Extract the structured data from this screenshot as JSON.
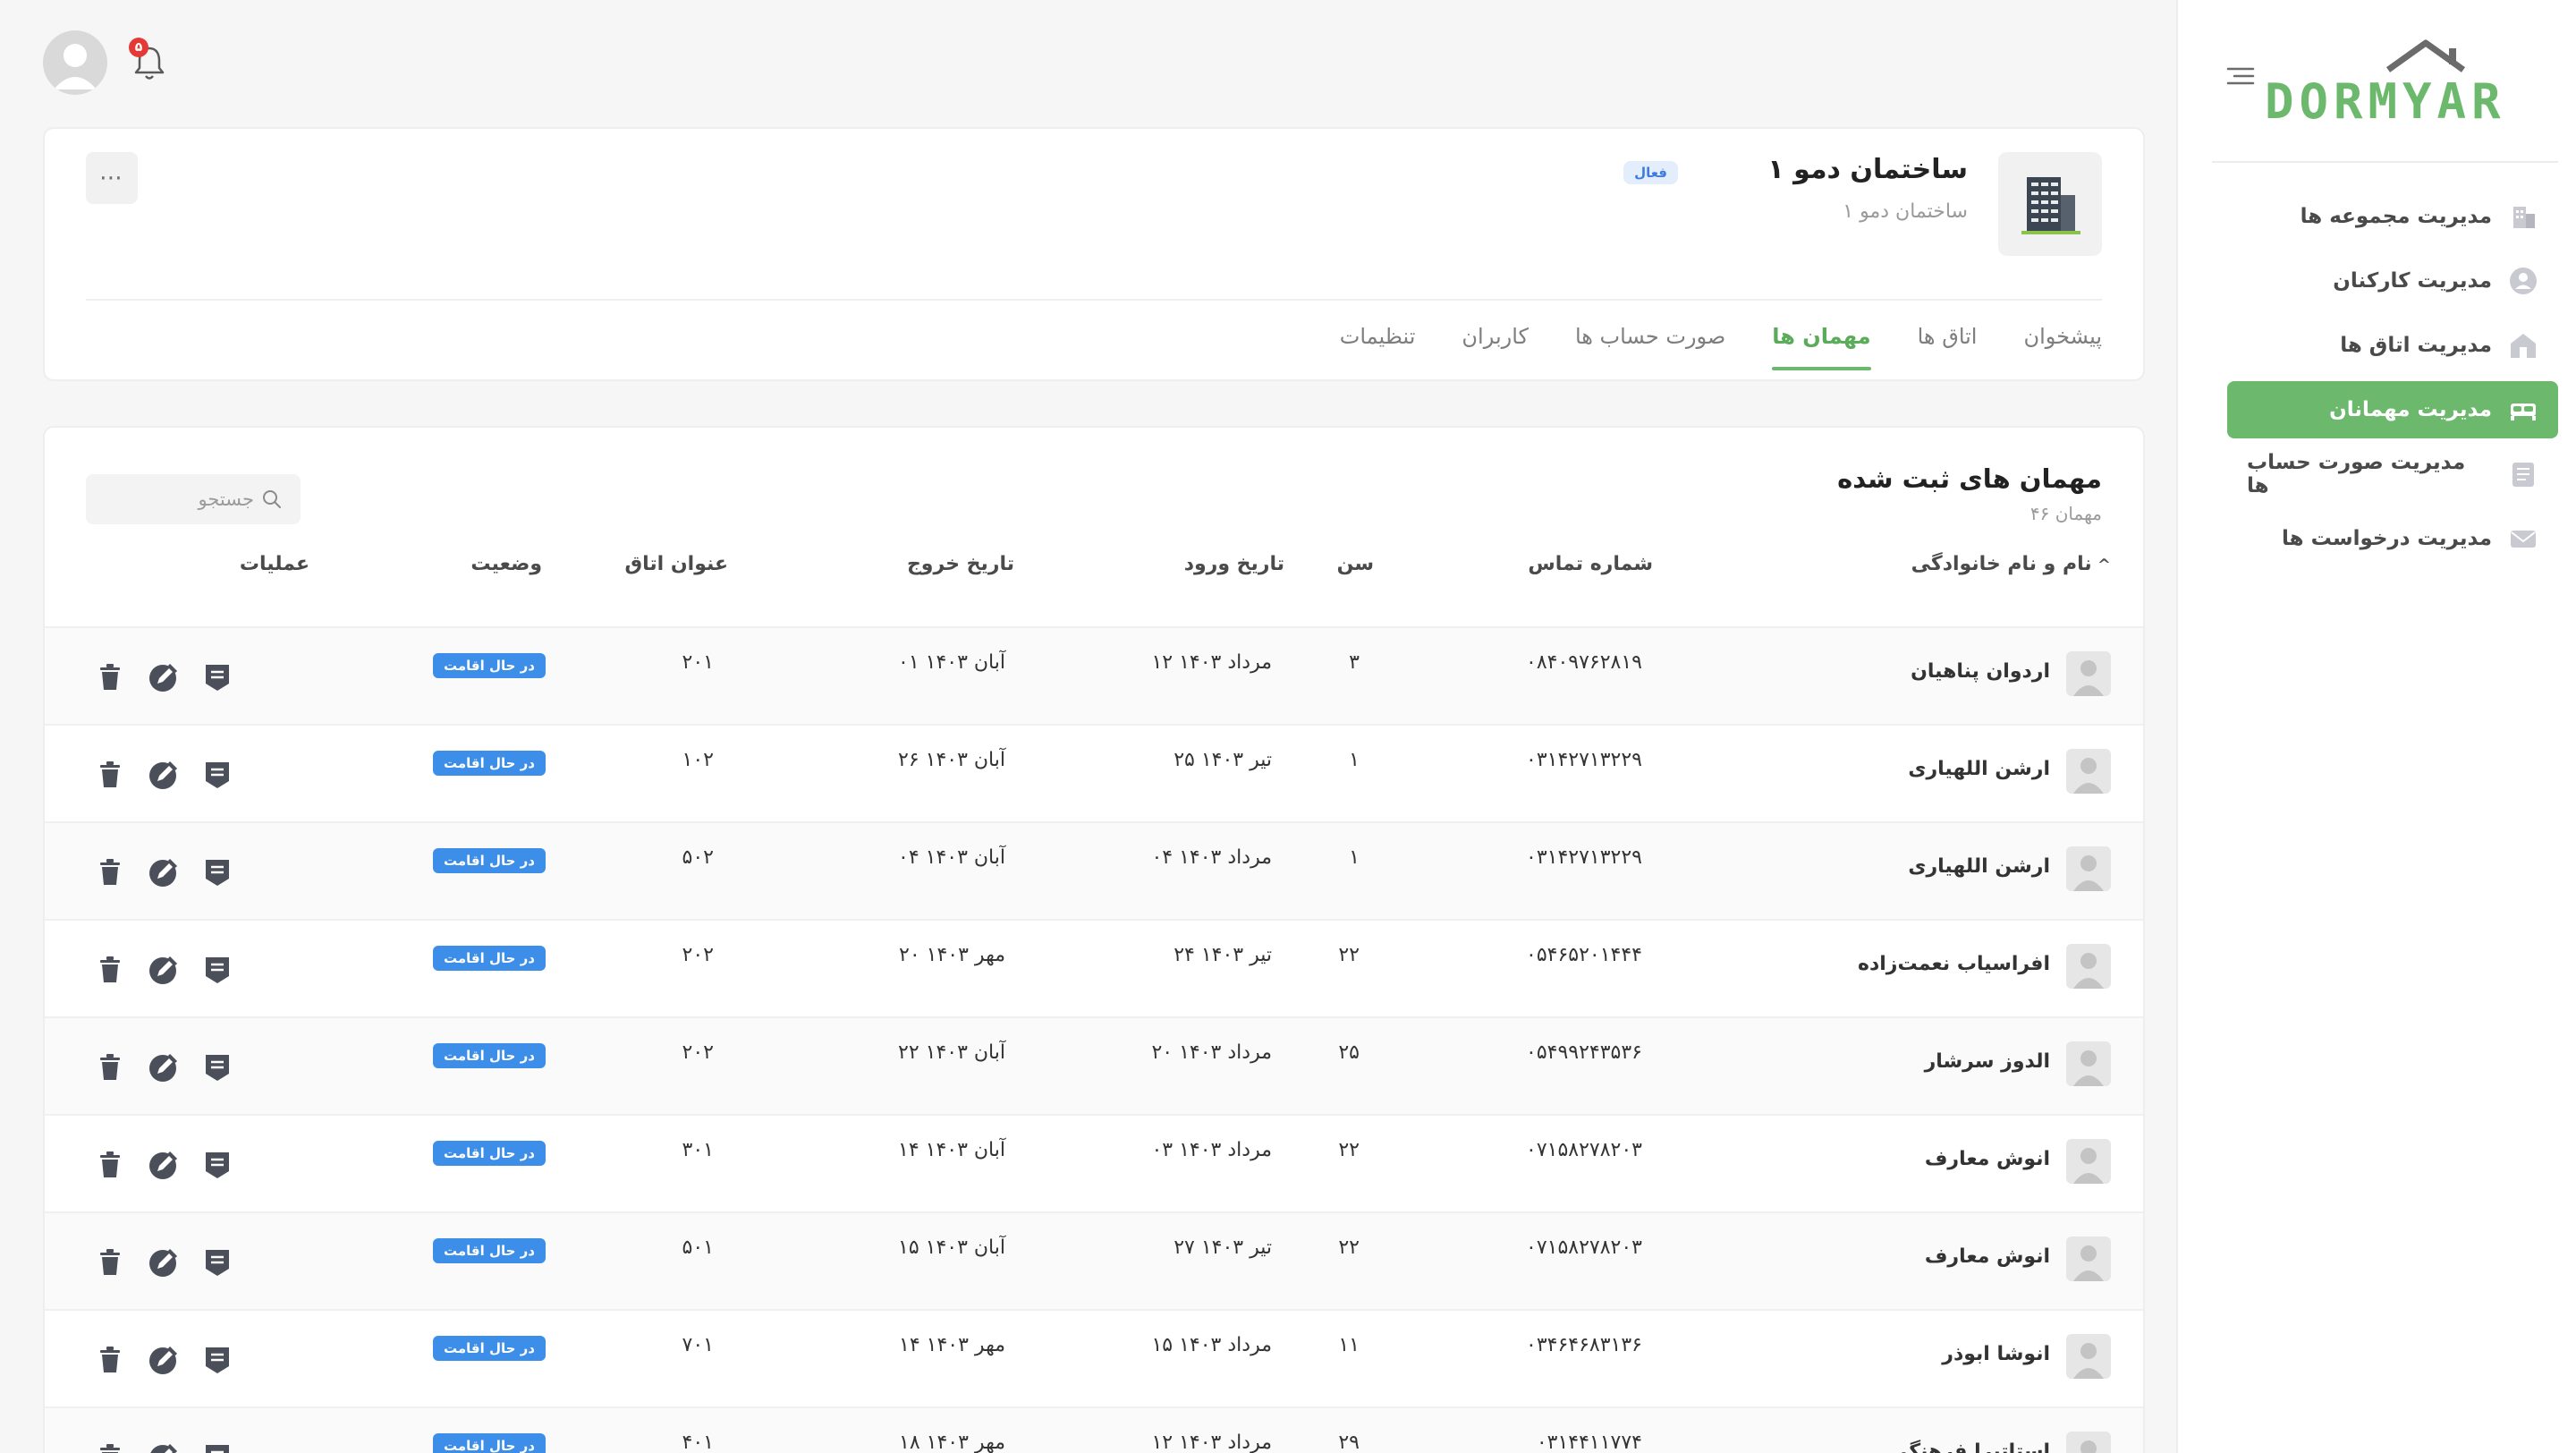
{
  "app": {
    "logo_text": "DORMYAR"
  },
  "sidebar": {
    "items": [
      {
        "label": "مدیریت مجموعه ها",
        "icon": "building-icon"
      },
      {
        "label": "مدیریت کارکنان",
        "icon": "user-icon"
      },
      {
        "label": "مدیریت اتاق ها",
        "icon": "house-icon"
      },
      {
        "label": "مدیریت مهمانان",
        "icon": "bed-icon",
        "active": true
      },
      {
        "label": "مدیریت صورت حساب ها",
        "icon": "invoice-icon"
      },
      {
        "label": "مدیریت درخواست ها",
        "icon": "mail-icon"
      }
    ]
  },
  "topbar": {
    "notification_count": "۵"
  },
  "building": {
    "title": "ساختمان دمو ۱",
    "status": "فعال",
    "subtitle": "ساختمان دمو ۱",
    "more": "⋯",
    "tabs": [
      {
        "label": "پیشخوان"
      },
      {
        "label": "اتاق ها"
      },
      {
        "label": "مهمان ها",
        "active": true
      },
      {
        "label": "صورت حساب ها"
      },
      {
        "label": "کاربران"
      },
      {
        "label": "تنظیمات"
      }
    ]
  },
  "guests": {
    "title": "مهمان های ثبت شده",
    "count": "۴۶ مهمان",
    "search_placeholder": "جستجو",
    "columns": {
      "name": "نام و نام خانوادگی",
      "phone": "شماره تماس",
      "age": "سن",
      "checkin": "تاریخ ورود",
      "checkout": "تاریخ خروج",
      "room": "عنوان اتاق",
      "status": "وضعیت",
      "actions": "عملیات"
    },
    "rows": [
      {
        "name": "اردوان پناهیان",
        "phone": "۰۸۴۰۹۷۶۲۸۱۹",
        "age": "۳",
        "checkin": "۱۲ مرداد ۱۴۰۳",
        "checkout": "۰۱ آبان ۱۴۰۳",
        "room": "۲۰۱",
        "status": "در حال اقامت"
      },
      {
        "name": "ارشن اللهیاری",
        "phone": "۰۳۱۴۲۷۱۳۲۲۹",
        "age": "۱",
        "checkin": "۲۵ تیر ۱۴۰۳",
        "checkout": "۲۶ آبان ۱۴۰۳",
        "room": "۱۰۲",
        "status": "در حال اقامت"
      },
      {
        "name": "ارشن اللهیاری",
        "phone": "۰۳۱۴۲۷۱۳۲۲۹",
        "age": "۱",
        "checkin": "۰۴ مرداد ۱۴۰۳",
        "checkout": "۰۴ آبان ۱۴۰۳",
        "room": "۵۰۲",
        "status": "در حال اقامت"
      },
      {
        "name": "افراسیاب نعمت‌زاده",
        "phone": "۰۵۴۶۵۲۰۱۴۴۴",
        "age": "۲۲",
        "checkin": "۲۴ تیر ۱۴۰۳",
        "checkout": "۲۰ مهر ۱۴۰۳",
        "room": "۲۰۲",
        "status": "در حال اقامت"
      },
      {
        "name": "الدوز سرشار",
        "phone": "۰۵۴۹۹۲۴۳۵۳۶",
        "age": "۲۵",
        "checkin": "۲۰ مرداد ۱۴۰۳",
        "checkout": "۲۲ آبان ۱۴۰۳",
        "room": "۲۰۲",
        "status": "در حال اقامت"
      },
      {
        "name": "انوش معارف",
        "phone": "۰۷۱۵۸۲۷۸۲۰۳",
        "age": "۲۲",
        "checkin": "۰۳ مرداد ۱۴۰۳",
        "checkout": "۱۴ آبان ۱۴۰۳",
        "room": "۳۰۱",
        "status": "در حال اقامت"
      },
      {
        "name": "انوش معارف",
        "phone": "۰۷۱۵۸۲۷۸۲۰۳",
        "age": "۲۲",
        "checkin": "۲۷ تیر ۱۴۰۳",
        "checkout": "۱۵ آبان ۱۴۰۳",
        "room": "۵۰۱",
        "status": "در حال اقامت"
      },
      {
        "name": "انوشا ابوذر",
        "phone": "۰۳۴۶۴۶۸۳۱۳۶",
        "age": "۱۱",
        "checkin": "۱۵ مرداد ۱۴۰۳",
        "checkout": "۱۴ مهر ۱۴۰۳",
        "room": "۷۰۱",
        "status": "در حال اقامت"
      },
      {
        "name": "استاتیرا فرهنگ",
        "phone": "۰۳۱۴۴۱۱۷۷۴",
        "age": "۲۹",
        "checkin": "۱۲ مرداد ۱۴۰۳",
        "checkout": "۱۸ مهر ۱۴۰۳",
        "room": "۴۰۱",
        "status": "در حال اقامت"
      }
    ]
  },
  "colors": {
    "accent": "#6cb86c",
    "badge": "#3d8ee8",
    "status_tag": "#3d7be0"
  }
}
